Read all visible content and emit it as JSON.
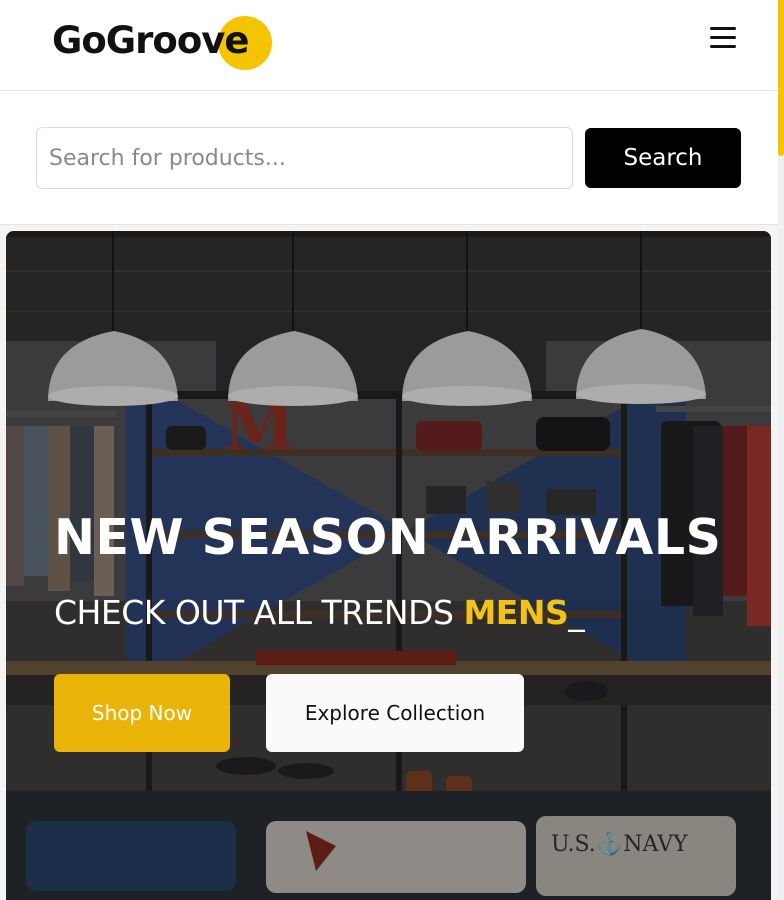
{
  "header": {
    "logo_text": "GoGroove",
    "accent_color": "#f5c400",
    "menu_icon": "hamburger-menu-icon"
  },
  "search": {
    "placeholder": "Search for products...",
    "value": "",
    "button_label": "Search"
  },
  "hero": {
    "title": "NEW SEASON ARRIVALS",
    "subtitle_prefix": "CHECK OUT ALL TRENDS ",
    "subtitle_highlight": "MENS",
    "subtitle_cursor": "_",
    "highlight_color": "#f2c21b",
    "primary_button": "Shop Now",
    "secondary_button": "Explore Collection",
    "background_scene": "clothing-store-interior"
  }
}
